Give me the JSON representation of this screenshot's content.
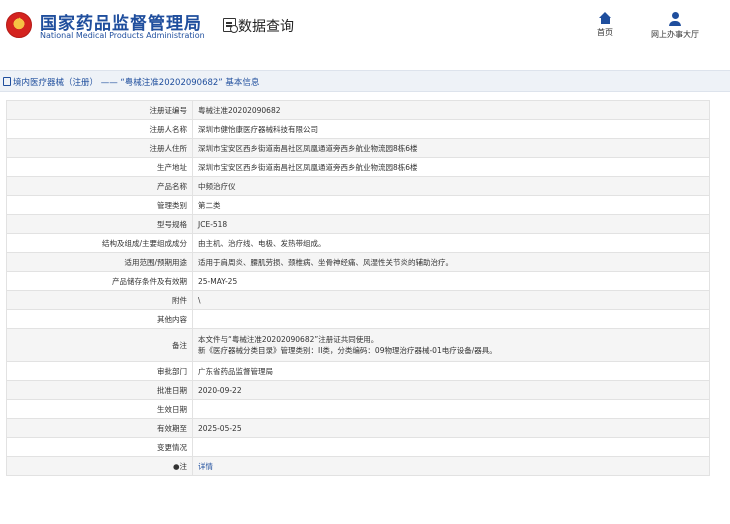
{
  "header": {
    "brand_cn": "国家药品监督管理局",
    "brand_en": "National Medical Products Administration",
    "query_label": "数据查询",
    "nav_home": "首页",
    "nav_service": "网上办事大厅"
  },
  "breadcrumb": "境内医疗器械（注册） —— “粤械注准20202090682” 基本信息",
  "rows": [
    {
      "label": "注册证编号",
      "value": "粤械注准20202090682"
    },
    {
      "label": "注册人名称",
      "value": "深圳市健怡康医疗器械科技有限公司"
    },
    {
      "label": "注册人住所",
      "value": "深圳市宝安区西乡街道南昌社区凤凰通道旁西乡航业物流园8栋6楼"
    },
    {
      "label": "生产地址",
      "value": "深圳市宝安区西乡街道南昌社区凤凰通道旁西乡航业物流园8栋6楼"
    },
    {
      "label": "产品名称",
      "value": "中频治疗仪"
    },
    {
      "label": "管理类别",
      "value": "第二类"
    },
    {
      "label": "型号规格",
      "value": "JCE-518"
    },
    {
      "label": "结构及组成/主要组成成分",
      "value": "由主机、治疗线、电极、发热带组成。"
    },
    {
      "label": "适用范围/预期用途",
      "value": "适用于肩周炎、腰肌劳损、颈椎病、坐骨神经痛、风湿性关节炎的辅助治疗。"
    },
    {
      "label": "产品储存条件及有效期",
      "value": "25-MAY-25"
    },
    {
      "label": "附件",
      "value": "\\"
    },
    {
      "label": "其他内容",
      "value": ""
    },
    {
      "label": "备注",
      "value_lines": [
        "本文件与“粤械注准20202090682”注册证共同使用。",
        "新《医疗器械分类目录》管理类别：II类，分类编码：09物理治疗器械-01电疗设备/器具。"
      ]
    },
    {
      "label": "审批部门",
      "value": "广东省药品监督管理局"
    },
    {
      "label": "批准日期",
      "value": "2020-09-22"
    },
    {
      "label": "生效日期",
      "value": ""
    },
    {
      "label": "有效期至",
      "value": "2025-05-25"
    },
    {
      "label": "变更情况",
      "value": ""
    },
    {
      "label": "●注",
      "value": "详情"
    }
  ]
}
